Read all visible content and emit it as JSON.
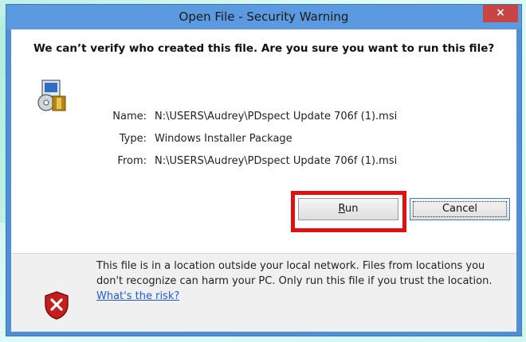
{
  "window": {
    "title": "Open File - Security Warning",
    "close_label": "×"
  },
  "warning": {
    "question": "We can’t verify who created this file. Are you sure you want to run this file?"
  },
  "file_info": {
    "rows": [
      {
        "label": "Name:",
        "value": "N:\\USERS\\Audrey\\PDspect Update 706f (1).msi"
      },
      {
        "label": "Type:",
        "value": "Windows Installer Package"
      },
      {
        "label": "From:",
        "value": "N:\\USERS\\Audrey\\PDspect Update 706f (1).msi"
      }
    ]
  },
  "buttons": {
    "run_label_underlined": "R",
    "run_label_rest": "un",
    "cancel_label": "Cancel"
  },
  "footer": {
    "text": "This file is in a location outside your local network. Files from locations you don't recognize can harm your PC. Only run this file if you trust the location.",
    "link_text": "What's the risk?"
  },
  "colors": {
    "titlebar": "#5b9ae0",
    "close_button": "#c74645",
    "highlight": "#e01010",
    "link": "#1f5bd8"
  },
  "icons": {
    "package": "windows-installer-package-icon",
    "shield": "security-shield-x-icon"
  }
}
